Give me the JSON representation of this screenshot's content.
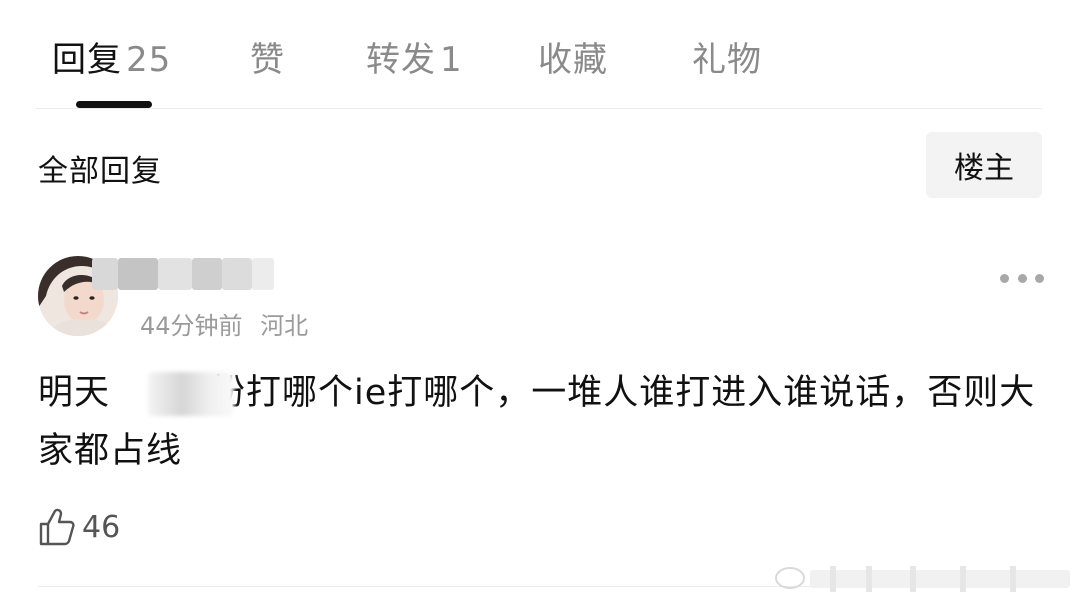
{
  "tabs": [
    {
      "label": "回复",
      "count": "25",
      "active": true
    },
    {
      "label": "赞",
      "count": "",
      "active": false
    },
    {
      "label": "转发",
      "count": "1",
      "active": false
    },
    {
      "label": "收藏",
      "count": "",
      "active": false
    },
    {
      "label": "礼物",
      "count": "",
      "active": false
    }
  ],
  "section": {
    "title": "全部回复",
    "filter_label": "楼主"
  },
  "comment": {
    "time": "44分钟前",
    "location": "河北",
    "text_before_mask": "明天",
    "text_after_mask": "粉打哪个ie打哪个，一堆人谁打进入谁说话，否则大家都占线",
    "likes": "46"
  },
  "icons": {
    "like": "thumbs-up-icon",
    "more": "more-dots-icon",
    "avatar": "user-avatar"
  },
  "colors": {
    "text_primary": "#111111",
    "text_secondary": "#8a8a8a",
    "divider": "#ececec",
    "filter_bg": "#f3f3f3"
  }
}
